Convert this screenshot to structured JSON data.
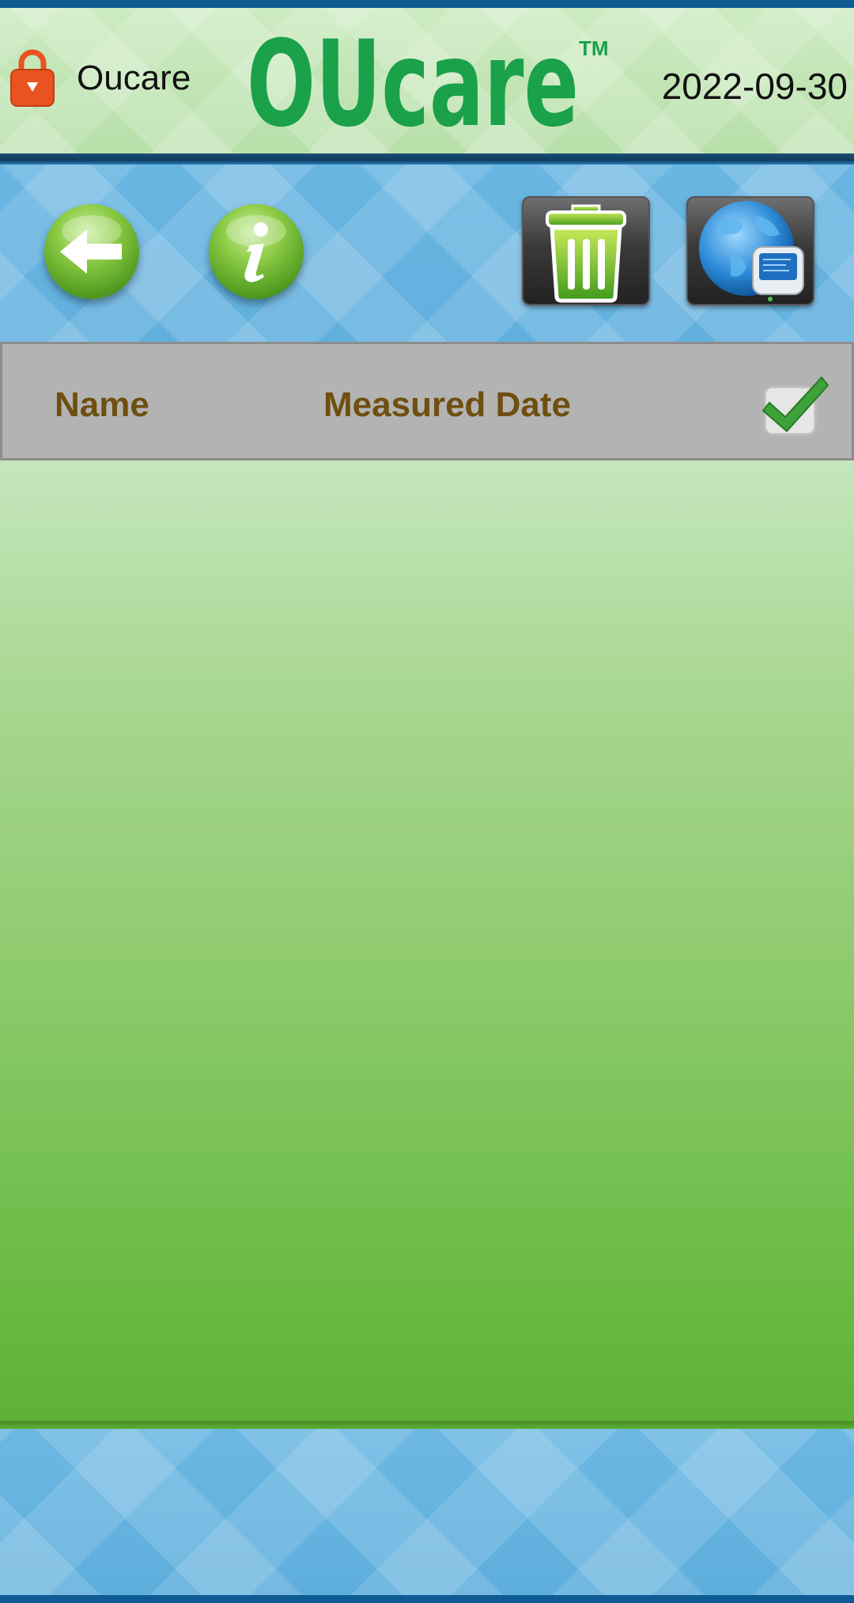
{
  "header": {
    "user_name": "Oucare",
    "logo_text": "OUcare",
    "trademark": "TM",
    "date": "2022-09-30"
  },
  "toolbar": {
    "buttons": [
      {
        "name": "back",
        "icon": "arrow-left-icon"
      },
      {
        "name": "info",
        "icon": "info-icon"
      },
      {
        "name": "delete",
        "icon": "trash-icon"
      },
      {
        "name": "upload",
        "icon": "globe-computer-icon"
      }
    ]
  },
  "table": {
    "columns": [
      "Name",
      "Measured Date"
    ],
    "select_all_checked": true,
    "rows": []
  },
  "colors": {
    "header_bg": "#c4e6b8",
    "toolbar_bg": "#66b3e0",
    "column_text": "#6e4f0f",
    "logo_green": "#1aa14a",
    "lock_orange": "#e8531f"
  }
}
